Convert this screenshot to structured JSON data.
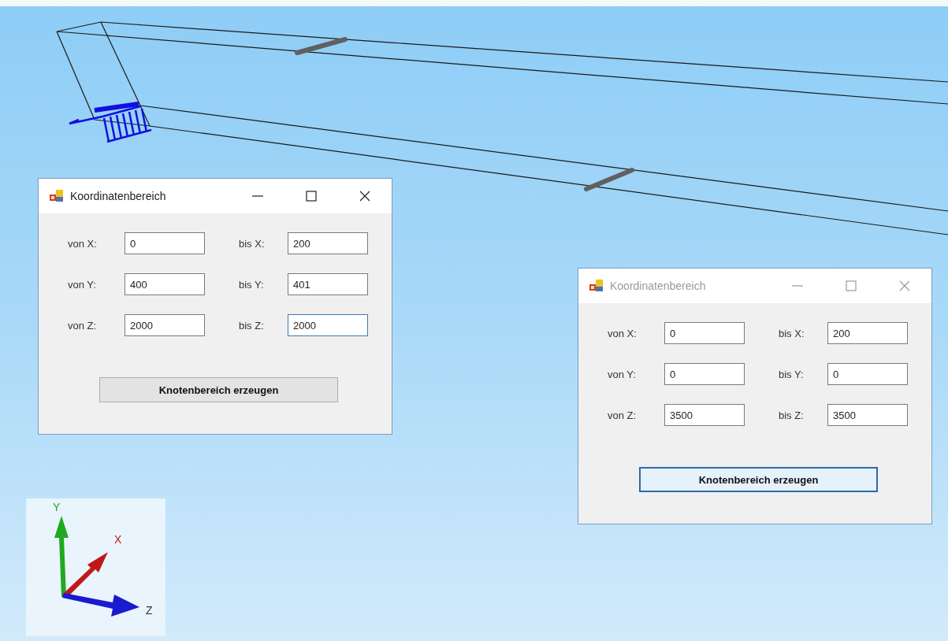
{
  "dialogs": [
    {
      "title": "Koordinatenbereich",
      "active": true,
      "fields": [
        {
          "label": "von X:",
          "value": "0",
          "focused": false
        },
        {
          "label": "bis X:",
          "value": "200",
          "focused": false
        },
        {
          "label": "von Y:",
          "value": "400",
          "focused": false
        },
        {
          "label": "bis Y:",
          "value": "401",
          "focused": false
        },
        {
          "label": "von Z:",
          "value": "2000",
          "focused": false
        },
        {
          "label": "bis Z:",
          "value": "2000",
          "focused": true
        }
      ],
      "button": {
        "label": "Knotenbereich erzeugen",
        "focused": false
      }
    },
    {
      "title": "Koordinatenbereich",
      "active": false,
      "fields": [
        {
          "label": "von X:",
          "value": "0",
          "focused": false
        },
        {
          "label": "bis X:",
          "value": "200",
          "focused": false
        },
        {
          "label": "von Y:",
          "value": "0",
          "focused": false
        },
        {
          "label": "bis Y:",
          "value": "0",
          "focused": false
        },
        {
          "label": "von Z:",
          "value": "3500",
          "focused": false
        },
        {
          "label": "bis Z:",
          "value": "3500",
          "focused": false
        }
      ],
      "button": {
        "label": "Knotenbereich erzeugen",
        "focused": true
      }
    }
  ],
  "axes": [
    {
      "label": "Y",
      "color": "#1faa1f"
    },
    {
      "label": "X",
      "color": "#c01818"
    },
    {
      "label": "Z",
      "color": "#1a1ad0"
    }
  ]
}
